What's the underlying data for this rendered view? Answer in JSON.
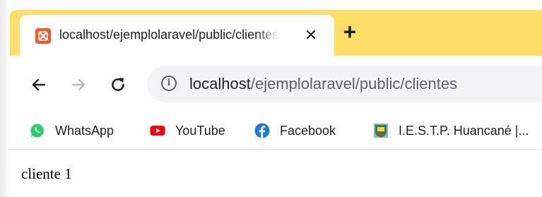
{
  "tab": {
    "title": "localhost/ejemplolaravel/public/clientes",
    "close_glyph": "✕",
    "new_tab_glyph": "+",
    "favicon": "xampp-icon"
  },
  "toolbar": {
    "back_icon": "back-arrow-icon",
    "forward_icon": "forward-arrow-icon",
    "reload_icon": "reload-icon"
  },
  "omnibox": {
    "info_glyph": "i",
    "url_host": "localhost",
    "url_path": "/ejemplolaravel/public/clientes"
  },
  "bookmarks": [
    {
      "label": "WhatsApp",
      "icon": "whatsapp-icon",
      "color": "#25d366"
    },
    {
      "label": "YouTube",
      "icon": "youtube-icon",
      "color": "#ff0000"
    },
    {
      "label": "Facebook",
      "icon": "facebook-icon",
      "color": "#1877f2"
    },
    {
      "label": "I.E.S.T.P. Huancané |...",
      "icon": "iestp-logo-icon",
      "color": "#3c7f3a"
    }
  ],
  "page": {
    "content_text": "cliente 1"
  },
  "colors": {
    "tabstrip": "#fddf67",
    "omnibox_bg": "#f1f3f4",
    "favicon": "#f2572d"
  }
}
